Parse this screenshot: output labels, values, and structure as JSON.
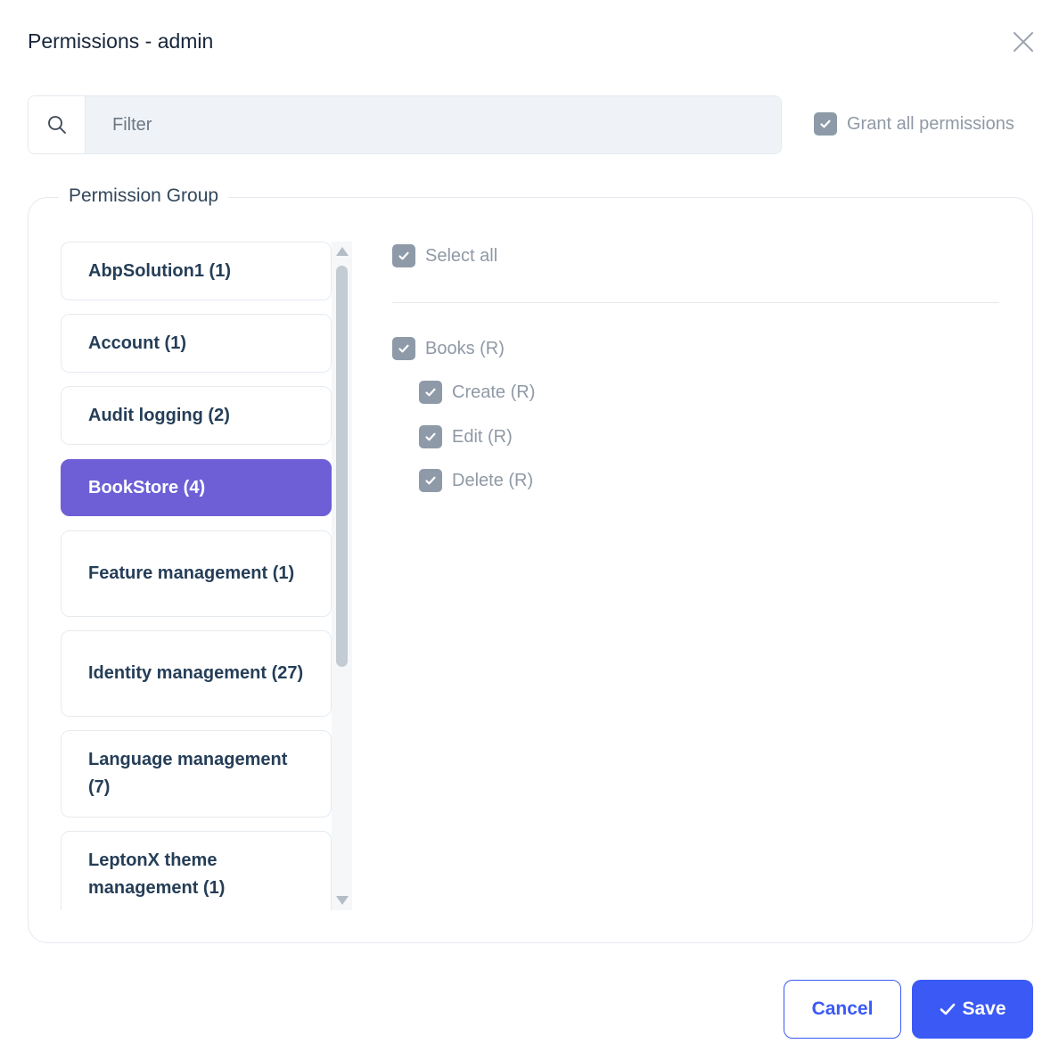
{
  "modal": {
    "title": "Permissions - admin"
  },
  "filter": {
    "placeholder": "Filter",
    "value": ""
  },
  "grant_all": {
    "label": "Grant all permissions",
    "checked": true
  },
  "permission_group": {
    "legend": "Permission Group",
    "groups": [
      {
        "label": "AbpSolution1 (1)",
        "active": false
      },
      {
        "label": "Account (1)",
        "active": false
      },
      {
        "label": "Audit logging (2)",
        "active": false
      },
      {
        "label": "BookStore (4)",
        "active": true
      },
      {
        "label": "Feature management (1)",
        "active": false
      },
      {
        "label": "Identity management (27)",
        "active": false
      },
      {
        "label": "Language management (7)",
        "active": false
      },
      {
        "label": "LeptonX theme management (1)",
        "active": false
      }
    ]
  },
  "permissions": {
    "select_all": {
      "label": "Select all",
      "checked": true
    },
    "items": [
      {
        "label": "Books (R)",
        "checked": true,
        "level": 0
      },
      {
        "label": "Create (R)",
        "checked": true,
        "level": 1
      },
      {
        "label": "Edit (R)",
        "checked": true,
        "level": 1
      },
      {
        "label": "Delete (R)",
        "checked": true,
        "level": 1
      }
    ]
  },
  "footer": {
    "cancel_label": "Cancel",
    "save_label": "Save"
  },
  "colors": {
    "accent": "#3b59f5",
    "active_group": "#6e5fd6",
    "checkbox": "#8e9aa8"
  },
  "icons": {
    "close": "close-icon",
    "search": "search-icon",
    "check": "check-icon"
  }
}
